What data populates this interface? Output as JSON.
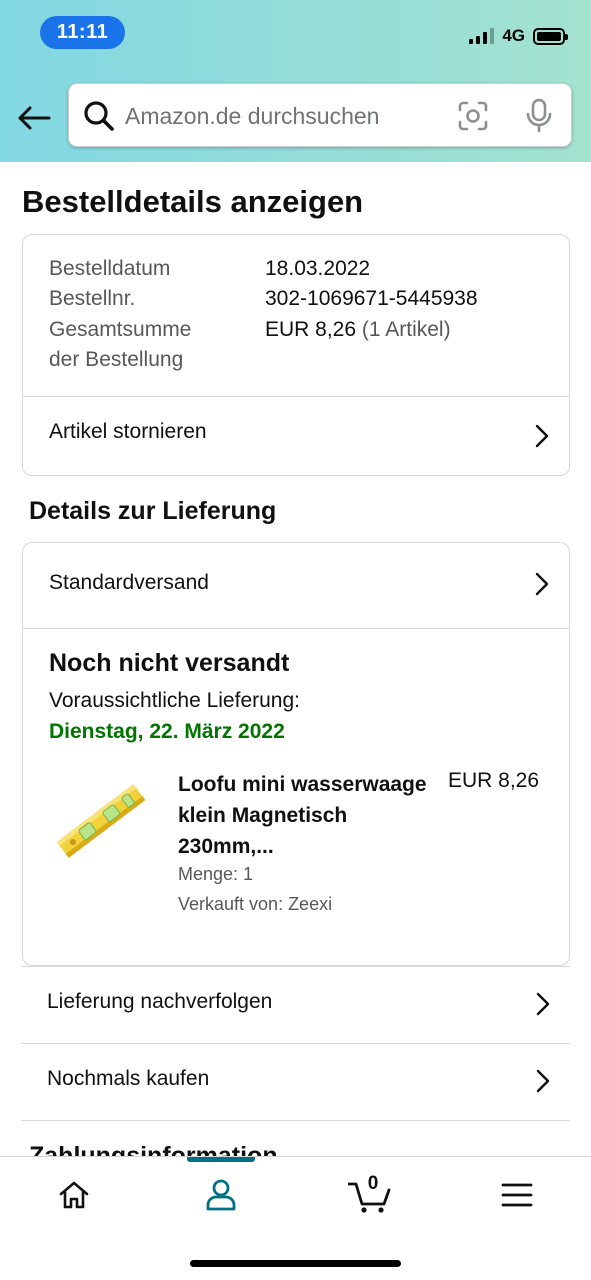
{
  "status": {
    "time": "11:11",
    "network": "4G"
  },
  "search": {
    "placeholder": "Amazon.de durchsuchen"
  },
  "page": {
    "title": "Bestelldetails anzeigen"
  },
  "order": {
    "date_label": "Bestelldatum",
    "date_value": "18.03.2022",
    "number_label": "Bestellnr.",
    "number_value": "302-1069671-5445938",
    "total_label_line1": "Gesamtsumme",
    "total_label_line2": "der Bestellung",
    "total_value": "EUR 8,26",
    "total_items": "(1 Artikel)",
    "cancel_label": "Artikel stornieren"
  },
  "delivery": {
    "section_title": "Details zur Lieferung",
    "method": "Standardversand",
    "status": "Noch nicht versandt",
    "eta_label": "Voraussichtliche Lieferung:",
    "eta_date": "Dienstag, 22. März 2022",
    "product": {
      "title": "Loofu mini wasserwaage klein Magnetisch 230mm,...",
      "price": "EUR 8,26",
      "quantity": "Menge: 1",
      "seller": "Verkauft von: Zeexi"
    }
  },
  "actions": {
    "track": "Lieferung nachverfolgen",
    "buy_again": "Nochmals kaufen"
  },
  "payment": {
    "section_title": "Zahlungsinformation"
  },
  "nav": {
    "cart_count": "0",
    "active": "account"
  },
  "colors": {
    "accent_green": "#007600",
    "nav_active": "#007185"
  }
}
